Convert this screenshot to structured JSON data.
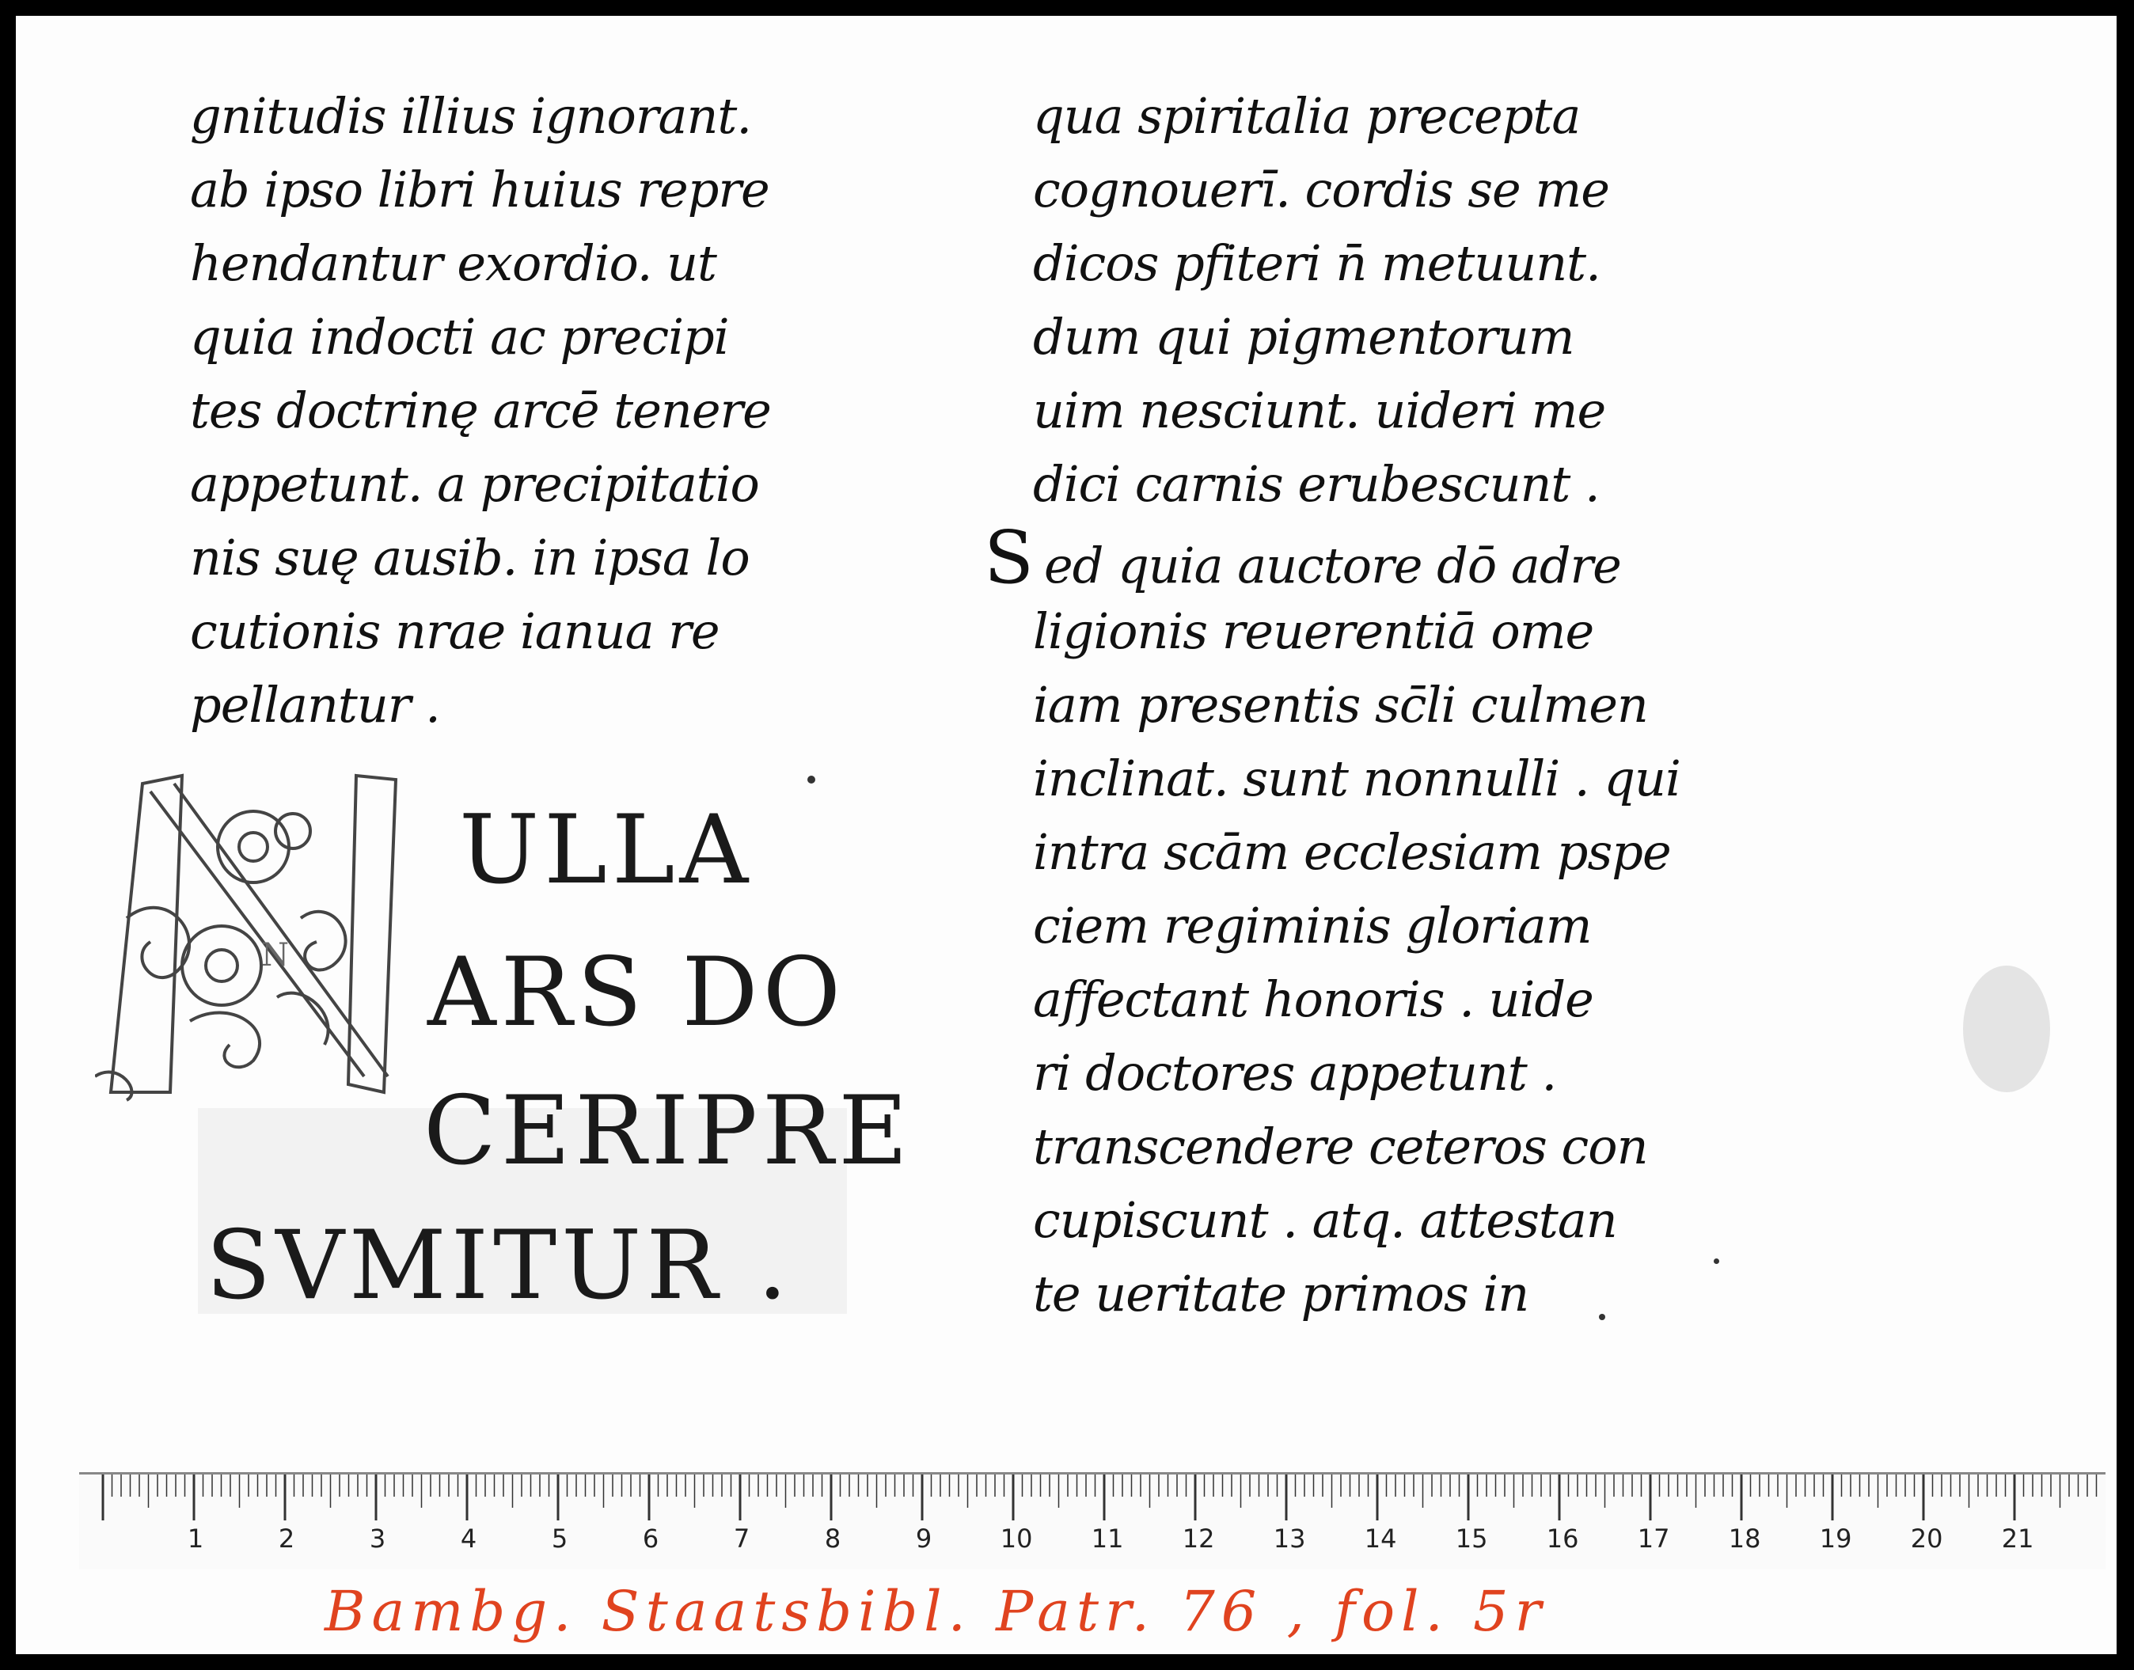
{
  "manuscript": {
    "left_column": [
      "gnitudis illius ignorant.",
      "ab ipso libri huius repre",
      "hendantur exordio. ut",
      "quia indocti ac precipi",
      "tes doctrinę arcē tenere",
      "appetunt. a precipitatio",
      "nis suę ausib. in ipsa lo",
      "cutionis nrae ianua re",
      "pellantur ."
    ],
    "right_column": [
      "qua spiritalia precepta",
      "cognouerī. cordis se me",
      "dicos pfiteri n̄ metuunt.",
      "dum qui pigmentorum",
      "uim nesciunt. uideri me",
      "dici carnis erubescunt ."
    ],
    "sed_initial": "S",
    "right_column_cont": [
      "ed quia auctore dō adre",
      "ligionis reuerentiā ome",
      "iam presentis sc̄li culmen",
      "inclinat. sunt nonnulli . qui",
      "intra scām ecclesiam pspe",
      "ciem regiminis gloriam",
      "affectant honoris . uide",
      "ri doctores appetunt .",
      "transcendere ceteros con",
      "cupiscunt . atq. attestan",
      "te ueritate primos in"
    ],
    "incipit": {
      "initial": "N",
      "line1": "ULLA",
      "line2": "ARS DO",
      "line3": "CERIPRE",
      "line4": "SVMITUR ."
    }
  },
  "ruler": {
    "labels": [
      "1",
      "2",
      "3",
      "4",
      "5",
      "6",
      "7",
      "8",
      "9",
      "10",
      "11",
      "12",
      "13",
      "14",
      "15",
      "16",
      "17",
      "18",
      "19",
      "20",
      "21"
    ]
  },
  "caption": "Bambg. Staatsbibl. Patr. 76 , fol. 5r"
}
